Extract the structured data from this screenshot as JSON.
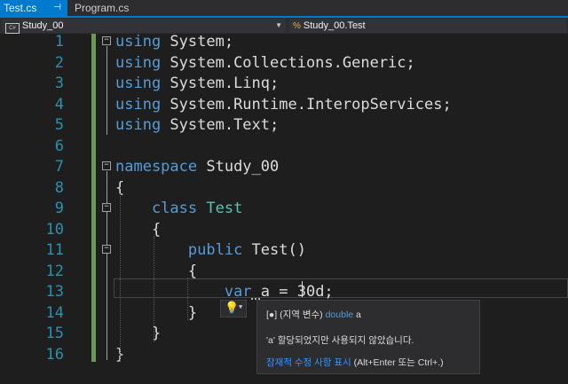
{
  "tabs": [
    {
      "label": "Test.cs",
      "pin": "⊣",
      "active": true
    },
    {
      "label": "Program.cs",
      "active": false
    }
  ],
  "navbar": {
    "left": {
      "badge": "C#",
      "label": "Study_00"
    },
    "right": {
      "label": "Study_00.Test"
    }
  },
  "editor": {
    "lines": [
      {
        "n": "1",
        "tokens": [
          {
            "t": "using",
            "c": "kw"
          },
          {
            "t": " System;"
          }
        ]
      },
      {
        "n": "2",
        "tokens": [
          {
            "t": "using",
            "c": "kw"
          },
          {
            "t": " System.Collections.Generic;"
          }
        ]
      },
      {
        "n": "3",
        "tokens": [
          {
            "t": "using",
            "c": "kw"
          },
          {
            "t": " System.Linq;"
          }
        ]
      },
      {
        "n": "4",
        "tokens": [
          {
            "t": "using",
            "c": "kw"
          },
          {
            "t": " System.Runtime.InteropServices;"
          }
        ]
      },
      {
        "n": "5",
        "tokens": [
          {
            "t": "using",
            "c": "kw"
          },
          {
            "t": " System.Text;"
          }
        ]
      },
      {
        "n": "6",
        "tokens": []
      },
      {
        "n": "7",
        "tokens": [
          {
            "t": "namespace",
            "c": "kw"
          },
          {
            "t": " Study_00"
          }
        ]
      },
      {
        "n": "8",
        "tokens": [
          {
            "t": "{"
          }
        ]
      },
      {
        "n": "9",
        "tokens": [
          {
            "t": "    "
          },
          {
            "t": "class",
            "c": "kw"
          },
          {
            "t": " "
          },
          {
            "t": "Test",
            "c": "typ"
          }
        ]
      },
      {
        "n": "10",
        "tokens": [
          {
            "t": "    {"
          }
        ]
      },
      {
        "n": "11",
        "tokens": [
          {
            "t": "        "
          },
          {
            "t": "public",
            "c": "kw"
          },
          {
            "t": " Test()"
          }
        ]
      },
      {
        "n": "12",
        "tokens": [
          {
            "t": "        {"
          }
        ]
      },
      {
        "n": "13",
        "tokens": [
          {
            "t": "            "
          },
          {
            "t": "var",
            "c": "kw"
          },
          {
            "t": " a = 30d;"
          }
        ]
      },
      {
        "n": "14",
        "tokens": [
          {
            "t": "        }"
          }
        ]
      },
      {
        "n": "15",
        "tokens": [
          {
            "t": "    }"
          }
        ]
      },
      {
        "n": "16",
        "tokens": [
          {
            "t": "}"
          }
        ]
      }
    ]
  },
  "tooltip": {
    "icon": "[●]",
    "kind": "(지역 변수)",
    "type_kw": "double",
    "name": "a",
    "message": "'a' 할당되었지만 사용되지 않았습니다.",
    "fix_link": "잠재적 수정 사항 표시",
    "shortcut": "(Alt+Enter 또는 Ctrl+.)"
  },
  "colors": {
    "accent": "#007acc",
    "keyword": "#569cd6",
    "type": "#4ec9b0",
    "line_number": "#2b91af",
    "change_bar": "#6a9955"
  }
}
